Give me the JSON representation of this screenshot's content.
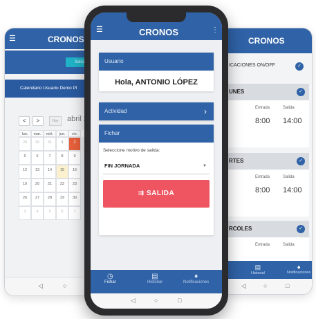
{
  "left": {
    "title": "CRONOS",
    "chip": "Solici",
    "calendar_title": "Calendario Usuario Demo Pl",
    "prev": "<",
    "next": ">",
    "today": "Hoy",
    "month": "abril 2",
    "weekdays": [
      "lun.",
      "mar.",
      "mié.",
      "jue.",
      "vie."
    ],
    "rows": [
      [
        "29",
        "30",
        "31",
        "1",
        "2"
      ],
      [
        "5",
        "6",
        "7",
        "8",
        "9"
      ],
      [
        "12",
        "13",
        "14",
        "15",
        "16"
      ],
      [
        "19",
        "20",
        "21",
        "22",
        "23"
      ],
      [
        "26",
        "27",
        "28",
        "29",
        "30"
      ],
      [
        "3",
        "4",
        "5",
        "6",
        "7"
      ]
    ]
  },
  "center": {
    "title": "CRONOS",
    "usuario_label": "Usuario",
    "greeting": "Hola, ANTONIO LÓPEZ",
    "actividad_label": "Actividad",
    "fichar_label": "Fichar",
    "motive_label": "Seleccione motivo de salida:",
    "motive_value": "FIN JORNADA",
    "salida_label": "SALIDA",
    "tabs": [
      {
        "label": "Fichar"
      },
      {
        "label": "Historial"
      },
      {
        "label": "Notificaciones"
      }
    ]
  },
  "right": {
    "title": "CRONOS",
    "notif_label": "ICACIONES ON/OFF",
    "days": [
      {
        "name": "UNES",
        "entrada_label": "Entrada",
        "salida_label": "Salida",
        "entrada": "8:00",
        "salida": "14:00"
      },
      {
        "name": "RTES",
        "entrada_label": "Entrada",
        "salida_label": "Salida",
        "entrada": "8:00",
        "salida": "14:00"
      },
      {
        "name": "RCOLES",
        "entrada_label": "Entrada",
        "salida_label": "Salida",
        "entrada": "",
        "salida": ""
      }
    ],
    "tabs": [
      {
        "label": "Historial"
      },
      {
        "label": "Notificaciones"
      }
    ]
  },
  "colors": {
    "primary": "#2f62a6",
    "danger": "#ee5560",
    "accent_red": "#e8603c",
    "today_yellow": "#fbf1cf"
  }
}
